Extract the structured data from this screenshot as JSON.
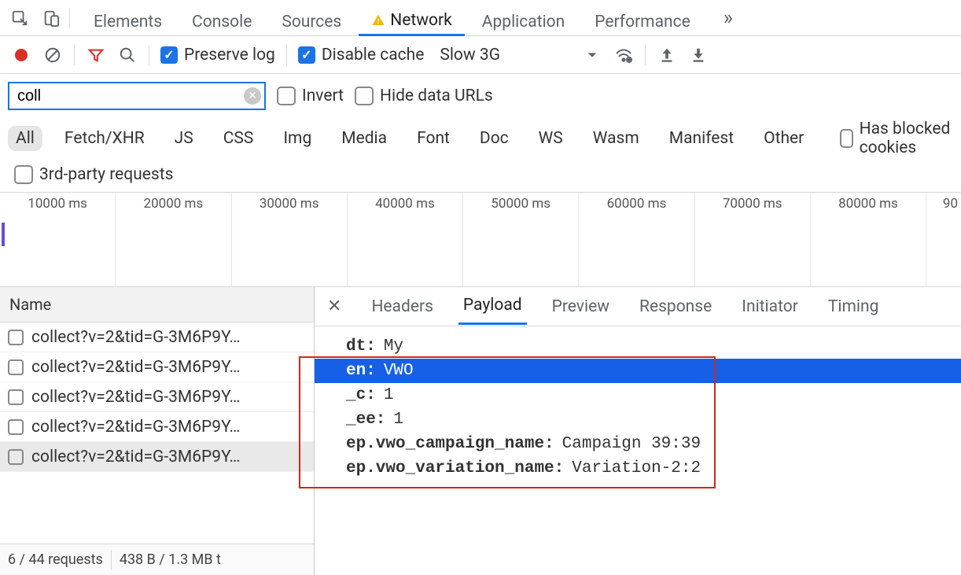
{
  "tabs": {
    "elements": "Elements",
    "console": "Console",
    "sources": "Sources",
    "network": "Network",
    "application": "Application",
    "performance": "Performance"
  },
  "toolbar": {
    "preserve_log": "Preserve log",
    "disable_cache": "Disable cache",
    "throttle": "Slow 3G"
  },
  "filter": {
    "value": "coll",
    "invert": "Invert",
    "hide_data": "Hide data URLs"
  },
  "types": {
    "all": "All",
    "fetch": "Fetch/XHR",
    "js": "JS",
    "css": "CSS",
    "img": "Img",
    "media": "Media",
    "font": "Font",
    "doc": "Doc",
    "ws": "WS",
    "wasm": "Wasm",
    "manifest": "Manifest",
    "other": "Other",
    "blocked": "Has blocked cookies"
  },
  "third_party": "3rd-party requests",
  "timeline": [
    "10000 ms",
    "20000 ms",
    "30000 ms",
    "40000 ms",
    "50000 ms",
    "60000 ms",
    "70000 ms",
    "80000 ms",
    "90"
  ],
  "list": {
    "header": "Name",
    "rows": [
      "collect?v=2&tid=G-3M6P9Y…",
      "collect?v=2&tid=G-3M6P9Y…",
      "collect?v=2&tid=G-3M6P9Y…",
      "collect?v=2&tid=G-3M6P9Y…",
      "collect?v=2&tid=G-3M6P9Y…"
    ],
    "selected_index": 4
  },
  "status": {
    "requests": "6 / 44 requests",
    "size": "438 B / 1.3 MB t"
  },
  "detail_tabs": {
    "headers": "Headers",
    "payload": "Payload",
    "preview": "Preview",
    "response": "Response",
    "initiator": "Initiator",
    "timing": "Timing"
  },
  "payload": [
    {
      "k": "dt:",
      "v": "My"
    },
    {
      "k": "en:",
      "v": "VWO"
    },
    {
      "k": "_c:",
      "v": "1"
    },
    {
      "k": "_ee:",
      "v": "1"
    },
    {
      "k": "ep.vwo_campaign_name:",
      "v": "Campaign 39:39"
    },
    {
      "k": "ep.vwo_variation_name:",
      "v": "Variation-2:2"
    }
  ],
  "payload_selected_index": 1
}
